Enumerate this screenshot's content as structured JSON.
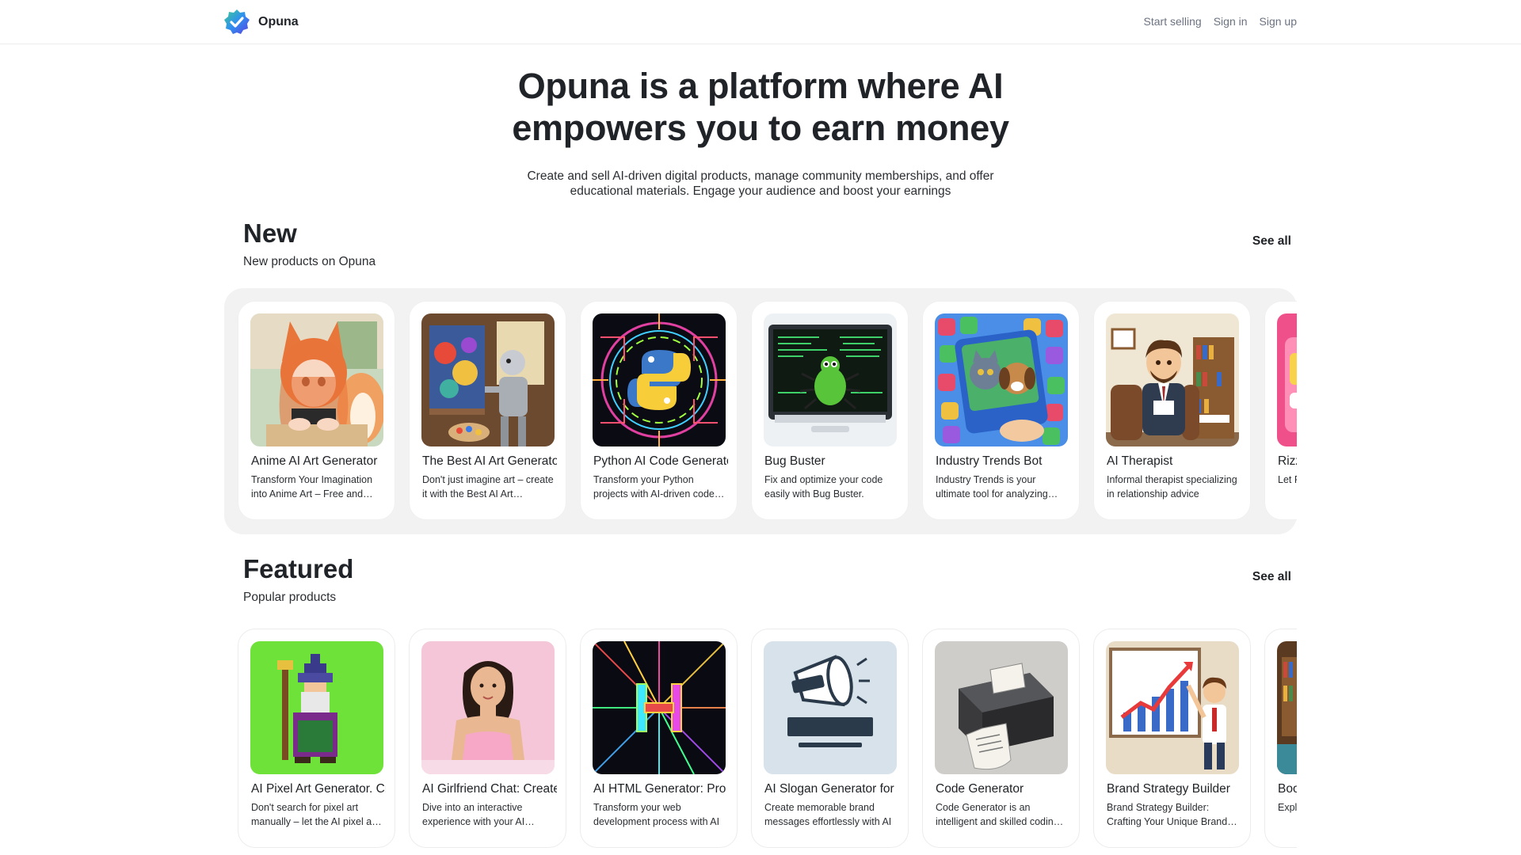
{
  "header": {
    "brand": "Opuna",
    "nav": {
      "start_selling": "Start selling",
      "sign_in": "Sign in",
      "sign_up": "Sign up"
    }
  },
  "hero": {
    "title_line1": "Opuna is a platform where AI",
    "title_line2": "empowers you to earn money",
    "subtitle": "Create and sell AI-driven digital products, manage community memberships, and offer educational materials. Engage your audience and boost your earnings"
  },
  "new_section": {
    "title": "New",
    "subtitle": "New products on Opuna",
    "see_all": "See all",
    "products": [
      {
        "title": "Anime AI Art Generator",
        "desc": "Transform Your Imagination into Anime Art – Free and Fast",
        "image": "anime-fox-girl"
      },
      {
        "title": "The Best AI Art Generator",
        "desc": "Don't just imagine art – create it with the Best AI Art Generator",
        "image": "robot-painter"
      },
      {
        "title": "Python AI Code Generator",
        "desc": "Transform your Python projects with AI-driven code generation",
        "image": "python-logo-neon"
      },
      {
        "title": "Bug Buster",
        "desc": "Fix and optimize your code easily with Bug Buster.",
        "image": "bug-monitor"
      },
      {
        "title": "Industry Trends Bot",
        "desc": "Industry Trends is your ultimate tool for analyzing trends",
        "image": "pets-social-likes"
      },
      {
        "title": "AI Therapist",
        "desc": "Informal therapist specializing in relationship advice",
        "image": "cartoon-therapist"
      },
      {
        "title": "Rizz",
        "desc": "Let R guide you",
        "image": "pink-app"
      }
    ]
  },
  "featured_section": {
    "title": "Featured",
    "subtitle": "Popular products",
    "see_all": "See all",
    "products": [
      {
        "title": "AI Pixel Art Generator. Create",
        "desc": "Don't search for pixel art manually – let the AI pixel art generator do it",
        "image": "pixel-wizard"
      },
      {
        "title": "AI Girlfriend Chat: Create",
        "desc": "Dive into an interactive experience with your AI girlfriend",
        "image": "girl-pink-bg"
      },
      {
        "title": "AI HTML Generator: Pro",
        "desc": "Transform your web development process with AI",
        "image": "neon-h-code"
      },
      {
        "title": "AI Slogan Generator for",
        "desc": "Create memorable brand messages effortlessly with AI",
        "image": "slogan-megaphone"
      },
      {
        "title": "Code Generator",
        "desc": "Code Generator is an intelligent and skilled coding assistant",
        "image": "receipt-printer"
      },
      {
        "title": "Brand Strategy Builder",
        "desc": "Brand Strategy Builder: Crafting Your Unique Brand Identity",
        "image": "presenter-chart"
      },
      {
        "title": "Boo",
        "desc": "Expl Liter",
        "image": "library"
      }
    ]
  },
  "colors": {
    "brand_blue": "#2f6fe4",
    "brand_green": "#2bb673",
    "row_bg": "#f2f2f2"
  }
}
